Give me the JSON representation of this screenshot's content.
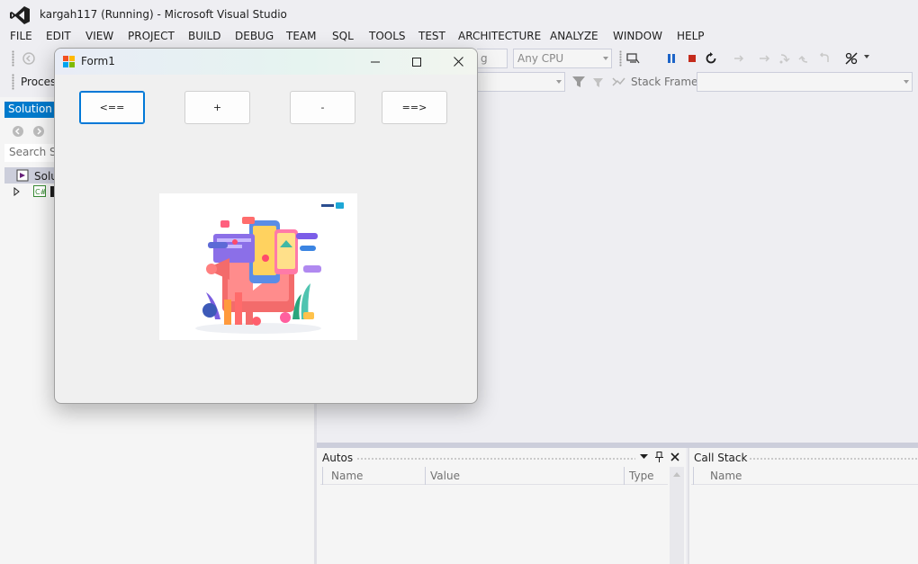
{
  "window": {
    "title": "kargah117 (Running) - Microsoft Visual Studio"
  },
  "menu": [
    "FILE",
    "EDIT",
    "VIEW",
    "PROJECT",
    "BUILD",
    "DEBUG",
    "TEAM",
    "SQL",
    "TOOLS",
    "TEST",
    "ARCHITECTURE",
    "ANALYZE",
    "WINDOW",
    "HELP"
  ],
  "toolbar": {
    "config_partial": "g",
    "platform": "Any CPU",
    "process_label": "Process",
    "stack_frame_label": "Stack Frame:"
  },
  "solution_explorer": {
    "tab_label": "Solution E",
    "search_placeholder": "Search So",
    "root_label": "Solu"
  },
  "form": {
    "title": "Form1",
    "buttons": [
      "<==",
      "+",
      "-",
      "==>"
    ]
  },
  "autos": {
    "title": "Autos",
    "columns": [
      "Name",
      "Value",
      "Type"
    ]
  },
  "call_stack": {
    "title": "Call Stack",
    "columns": [
      "Name"
    ]
  },
  "colors": {
    "accent": "#007acc",
    "stop": "#c42b1c",
    "pause": "#1e64c8",
    "focus": "#0078d7"
  }
}
